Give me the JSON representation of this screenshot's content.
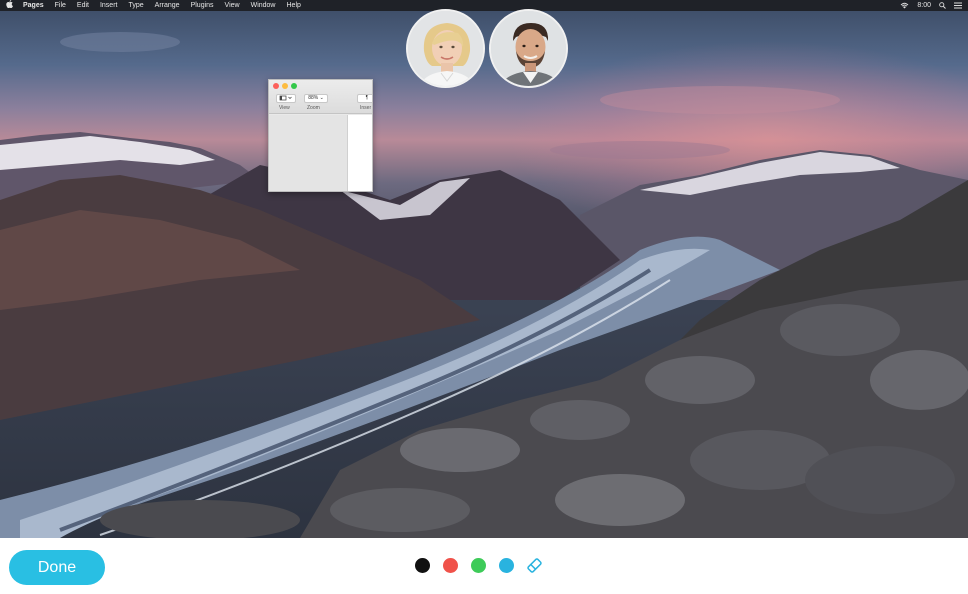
{
  "menubar": {
    "apple_icon": "apple-icon",
    "items": [
      "Pages",
      "File",
      "Edit",
      "Insert",
      "Type",
      "Arrange",
      "Plugins",
      "View",
      "Window",
      "Help"
    ],
    "time": "8:00",
    "icons": [
      "wifi-icon",
      "search-icon",
      "list-icon"
    ]
  },
  "participants": [
    {
      "icon": "avatar-woman"
    },
    {
      "icon": "avatar-man"
    }
  ],
  "pages_window": {
    "zoom_value": "88%",
    "view_label": "View",
    "zoom_label": "Zoom",
    "insert_label": "Inser",
    "insert_glyph": "¶"
  },
  "bottom_bar": {
    "done_label": "Done",
    "colors": {
      "black": "#111111",
      "red": "#f0524a",
      "green": "#3ecb59",
      "blue": "#29b3df",
      "accent": "#29bfe3"
    },
    "eraser_icon": "eraser-icon"
  }
}
